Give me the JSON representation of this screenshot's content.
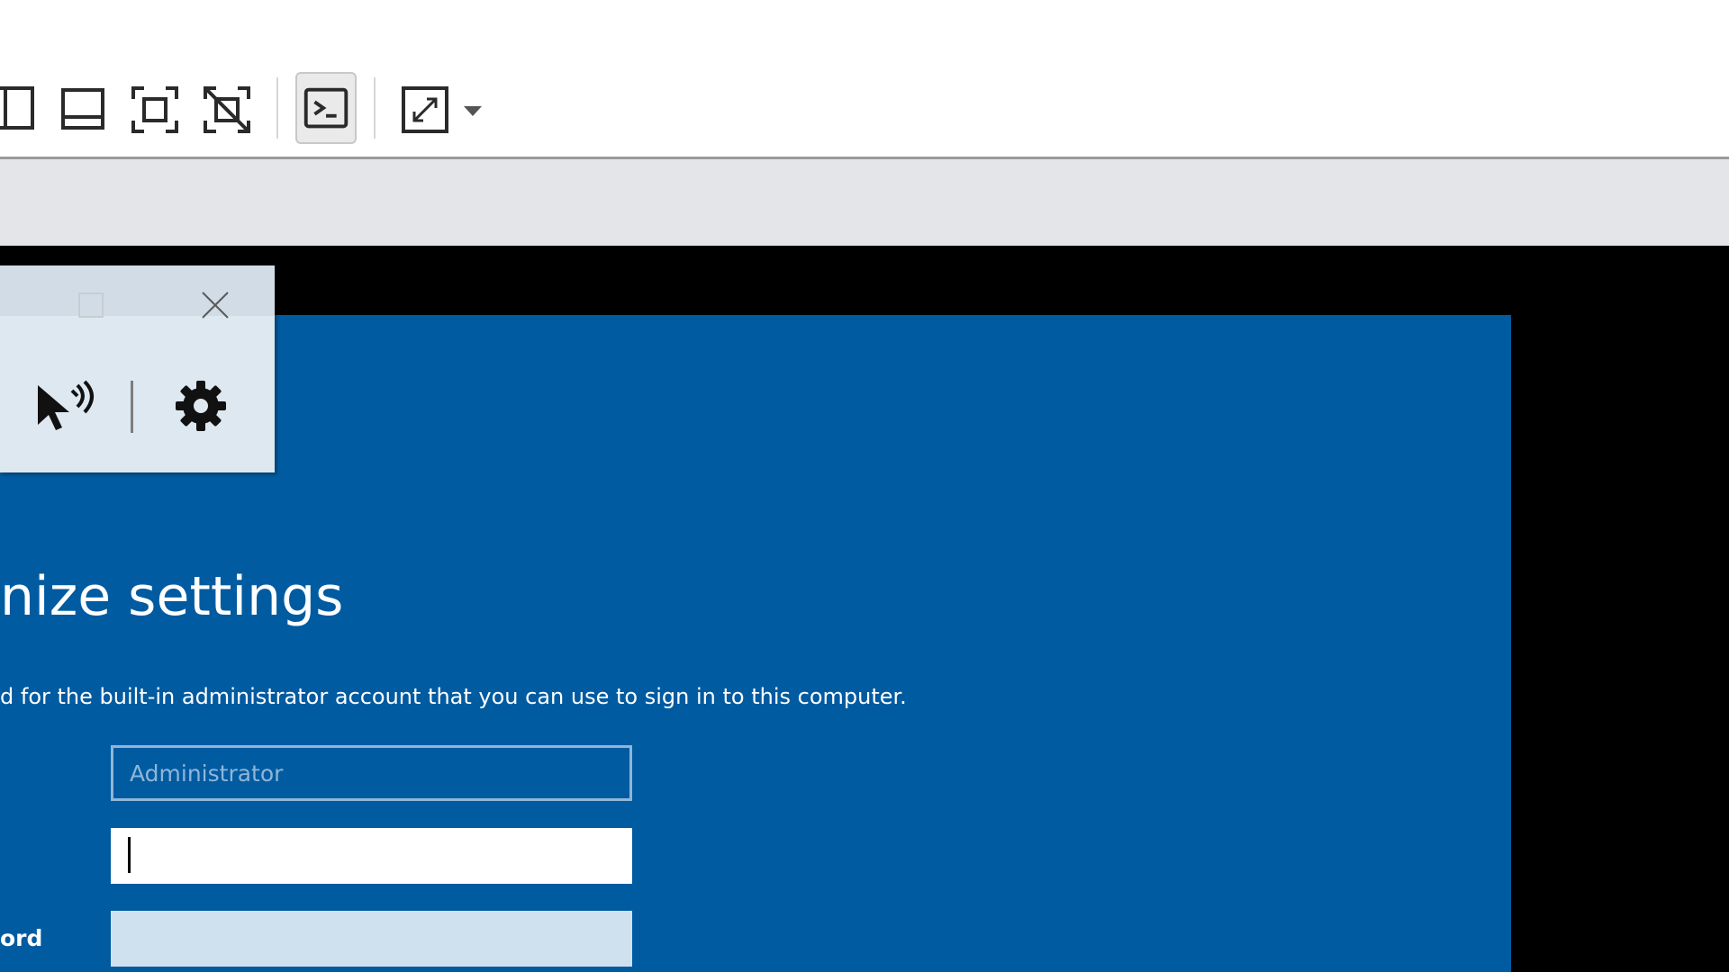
{
  "toolbar": {
    "icons": [
      "panel-left-icon",
      "panel-bottom-icon",
      "fit-window-icon",
      "disable-fit-icon",
      "console-icon",
      "fullscreen-icon",
      "chevron-down-icon"
    ]
  },
  "floating_toolbar": {
    "icons": [
      "maximize-icon",
      "close-icon",
      "pointer-announce-icon",
      "gear-icon"
    ]
  },
  "setup": {
    "title": "nize settings",
    "description": "d for the built-in administrator account that you can use to sign in to this computer.",
    "user_name_placeholder": "Administrator",
    "password_value": "",
    "confirm_label": "ord",
    "confirm_value": ""
  },
  "colors": {
    "setup_background": "#005ba1",
    "vm_background": "#000000",
    "gray_bar": "#e4e5e8"
  }
}
